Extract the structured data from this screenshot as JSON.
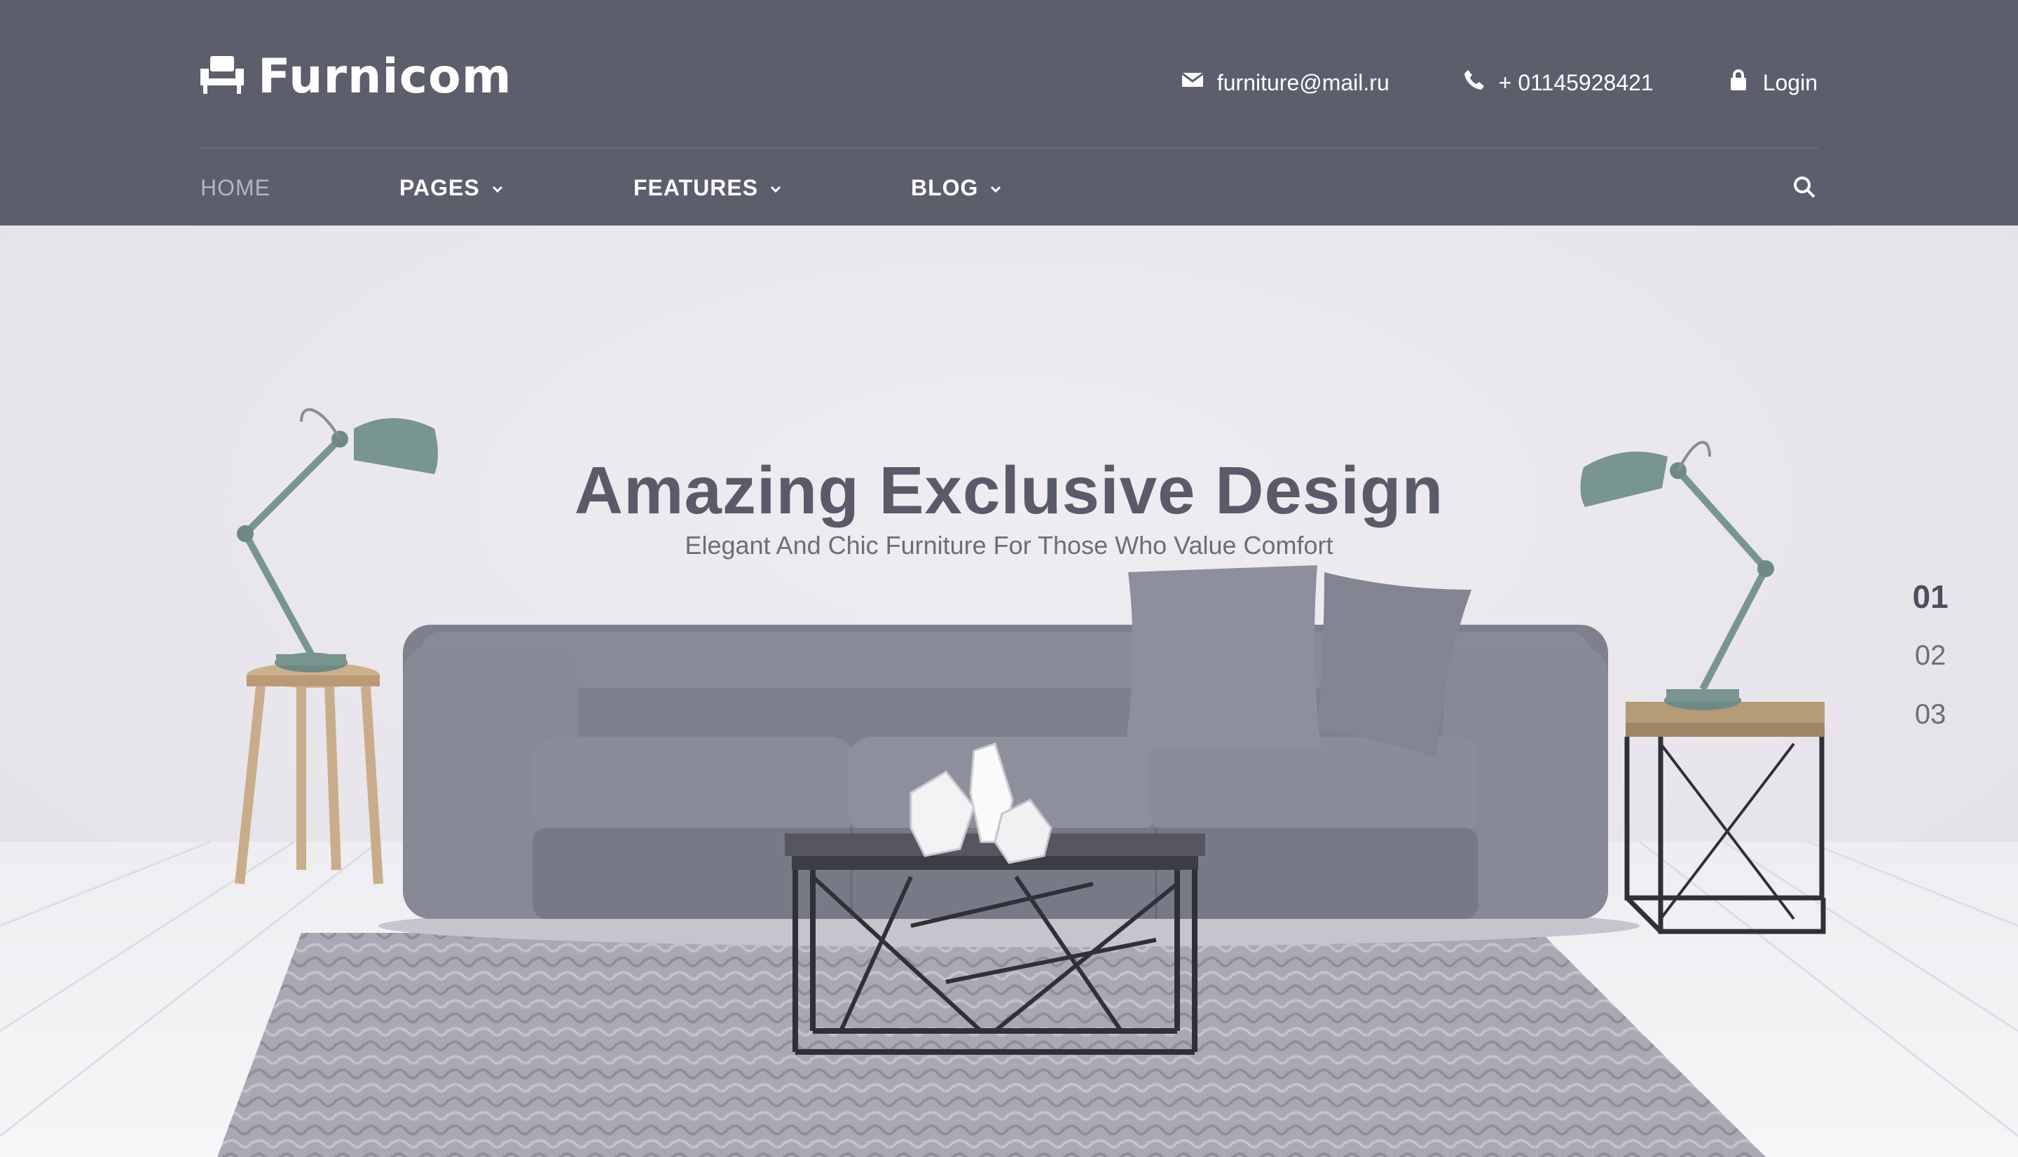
{
  "brand": {
    "name": "Furnicom",
    "icon": "armchair-icon"
  },
  "contacts": {
    "email": {
      "icon": "envelope-icon",
      "text": "furniture@mail.ru"
    },
    "phone": {
      "icon": "phone-icon",
      "text": "+ 01145928421"
    },
    "login": {
      "icon": "lock-icon",
      "text": "Login"
    }
  },
  "nav": {
    "home": "HOME",
    "pages": "PAGES",
    "features": "FEATURES",
    "blog": "BLOG",
    "search_icon": "search-icon"
  },
  "hero": {
    "title": "Amazing Exclusive Design",
    "subtitle": "Elegant And Chic Furniture For Those Who Value Comfort"
  },
  "slider": {
    "pages": [
      "01",
      "02",
      "03"
    ],
    "active_index": 0
  },
  "colors": {
    "header_bg": "#5c5e6c",
    "hero_bg": "#e9e7ec",
    "sofa": "#7e7f8d",
    "lamp": "#79958f",
    "wood": "#c9ad8a"
  }
}
